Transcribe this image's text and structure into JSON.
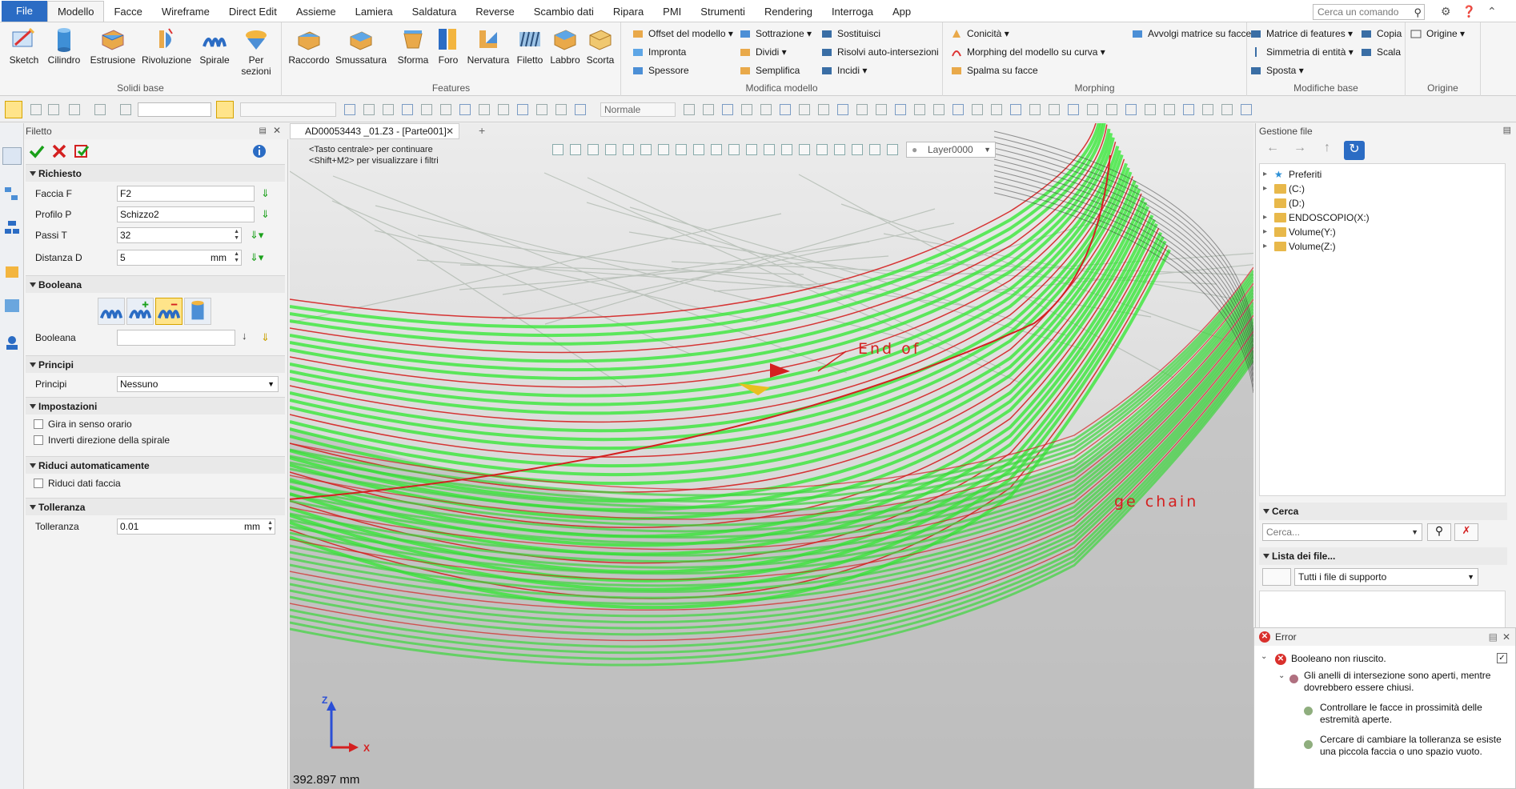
{
  "menubar": {
    "tabs": [
      "File",
      "Modello",
      "Facce",
      "Wireframe",
      "Direct Edit",
      "Assieme",
      "Lamiera",
      "Saldatura",
      "Reverse",
      "Scambio dati",
      "Ripara",
      "PMI",
      "Strumenti",
      "Rendering",
      "Interroga",
      "App"
    ],
    "search_placeholder": "Cerca un comando"
  },
  "ribbon": {
    "solidi_base": {
      "title": "Solidi base",
      "buttons": [
        "Sketch",
        "Cilindro",
        "Estrusione",
        "Rivoluzione",
        "Spirale",
        "Per sezioni"
      ]
    },
    "features": {
      "title": "Features",
      "buttons": [
        "Raccordo",
        "Smussatura",
        "Sforma",
        "Foro",
        "Nervatura",
        "Filetto",
        "Labbro",
        "Scorta"
      ]
    },
    "modifica_modello": {
      "title": "Modifica modello",
      "col1": [
        "Offset del modello",
        "Impronta",
        "Spessore"
      ],
      "col2": [
        "Sottrazione",
        "Dividi",
        "Semplifica"
      ],
      "col3": [
        "Sostituisci",
        "Risolvi auto-intersezioni",
        "Incidi"
      ]
    },
    "morphing": {
      "title": "Morphing",
      "col1": [
        "Conicità",
        "Morphing del modello su curva",
        "Spalma su facce"
      ],
      "col2": [
        "Avvolgi matrice su facce"
      ]
    },
    "modifiche_base": {
      "title": "Modifiche base",
      "col1": [
        "Matrice di features",
        "Simmetria di entità",
        "Sposta"
      ],
      "col2": [
        "Copia",
        "Scala"
      ]
    },
    "origine": {
      "title": "Origine",
      "buttons": [
        "Origine"
      ]
    }
  },
  "toolbar2": {
    "view_mode": "Normale"
  },
  "filetto_panel": {
    "title": "Filetto",
    "sections": {
      "richiesto": "Richiesto",
      "booleana": "Booleana",
      "principi": "Principi",
      "impostazioni": "Impostazioni",
      "riduci": "Riduci automaticamente",
      "tolleranza": "Tolleranza"
    },
    "fields": {
      "faccia_label": "Faccia F",
      "faccia_value": "F2",
      "profilo_label": "Profilo P",
      "profilo_value": "Schizzo2",
      "passi_label": "Passi T",
      "passi_value": "32",
      "distanza_label": "Distanza D",
      "distanza_value": "5",
      "distanza_unit": "mm",
      "booleana_label": "Booleana",
      "booleana_value": "",
      "principi_label": "Principi",
      "principi_value": "Nessuno",
      "tolleranza_label": "Tolleranza",
      "tolleranza_value": "0.01",
      "tolleranza_unit": "mm"
    },
    "checkboxes": {
      "gira": "Gira in senso orario",
      "inverti": "Inverti direzione della spirale",
      "riduci_dati": "Riduci dati faccia"
    }
  },
  "viewport": {
    "doc_tab": "AD00053443 _01.Z3 - [Parte001]",
    "hint_line1": "<Tasto centrale> per continuare",
    "hint_line2": "<Shift+M2> per visualizzare i filtri",
    "layer": "Layer0000",
    "annotation_end": "End of",
    "annotation_chain": "ge  chain",
    "measurement": "392.897 mm",
    "axis_z": "Z",
    "axis_x": "X"
  },
  "gestione_file": {
    "title": "Gestione file",
    "items": [
      "Preferiti",
      "(C:)",
      "(D:)",
      "ENDOSCOPIO(X:)",
      "Volume(Y:)",
      "Volume(Z:)"
    ],
    "cerca_title": "Cerca",
    "cerca_placeholder": "Cerca...",
    "lista_title": "Lista dei file...",
    "lista_value": "Tutti i file di supporto"
  },
  "error_panel": {
    "title": "Error",
    "main": "Booleano non riuscito.",
    "detail": "Gli anelli di intersezione sono aperti, mentre dovrebbero essere chiusi.",
    "hint1": "Controllare le facce in prossimità delle estremità aperte.",
    "hint2": "Cercare di cambiare la tolleranza se esiste una piccola faccia o uno spazio vuoto."
  },
  "colors": {
    "accent": "#2b6cc4",
    "green_geometry": "#2ee82e",
    "red_edges": "#d42020",
    "error_red": "#d9302c"
  }
}
